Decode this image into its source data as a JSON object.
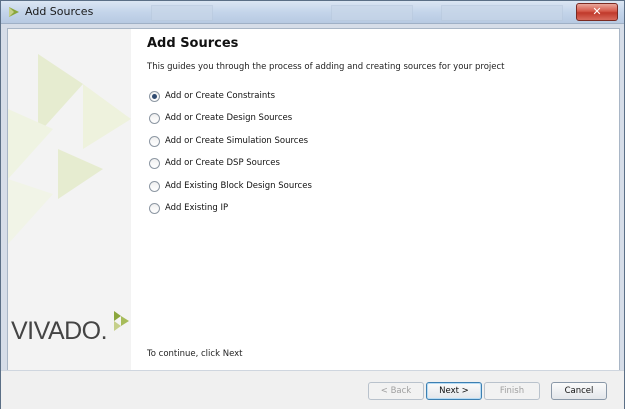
{
  "window": {
    "title": "Add Sources",
    "close_symbol": "✕"
  },
  "brand": {
    "logo_text": "VIVADO.",
    "accent_color": "#c5cf8a"
  },
  "page": {
    "heading": "Add Sources",
    "description": "This guides you through the process of adding and creating sources for your project",
    "footer": "To continue, click Next"
  },
  "options": [
    {
      "label": "Add or Create Constraints",
      "checked": true
    },
    {
      "label": "Add or Create Design Sources",
      "checked": false
    },
    {
      "label": "Add or Create Simulation Sources",
      "checked": false
    },
    {
      "label": "Add or Create DSP Sources",
      "checked": false
    },
    {
      "label": "Add Existing Block Design Sources",
      "checked": false
    },
    {
      "label": "Add Existing IP",
      "checked": false
    }
  ],
  "buttons": {
    "back": "< Back",
    "next": "Next >",
    "finish": "Finish",
    "cancel": "Cancel"
  }
}
